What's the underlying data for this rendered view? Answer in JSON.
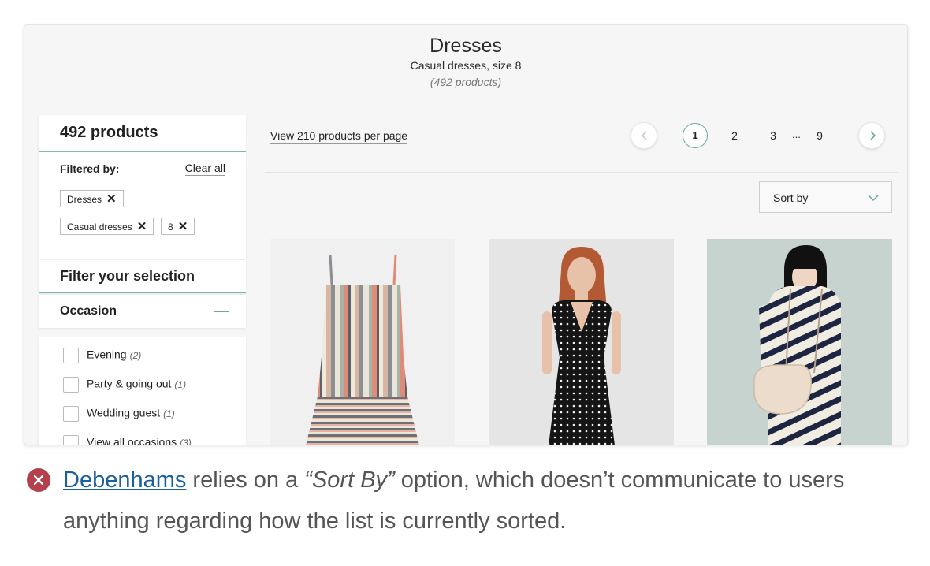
{
  "header": {
    "title": "Dresses",
    "subtitle": "Casual dresses, size 8",
    "count": "(492 products)"
  },
  "sidebar": {
    "products_count": "492 products",
    "filtered_by_label": "Filtered by:",
    "clear_all": "Clear all",
    "chips": [
      "Dresses",
      "Casual dresses",
      "8"
    ],
    "filter_title": "Filter your selection",
    "occasion_title": "Occasion",
    "occasions": [
      {
        "label": "Evening",
        "count": "(2)"
      },
      {
        "label": "Party & going out",
        "count": "(1)"
      },
      {
        "label": "Wedding guest",
        "count": "(1)"
      },
      {
        "label": "View all occasions",
        "count": "(3)"
      }
    ]
  },
  "toolbar": {
    "per_page": "View 210 products per page",
    "pages": [
      "1",
      "2",
      "3",
      "9"
    ],
    "current_page": "1",
    "ellipsis": "...",
    "sort_label": "Sort by"
  },
  "products": [
    {
      "alt": "Striped strappy dress"
    },
    {
      "alt": "Polka dot sleeveless dress"
    },
    {
      "alt": "Striped shirt dress with bag"
    }
  ],
  "caption": {
    "link": "Debenhams",
    "text_before_quote": " relies on a ",
    "quote": "“Sort By”",
    "text_after_quote": " option, which doesn’t communicate to users anything regarding how the list is currently sorted."
  },
  "colors": {
    "accent": "#6aa9a3",
    "error": "#b3404a",
    "link": "#1c5f9e"
  }
}
